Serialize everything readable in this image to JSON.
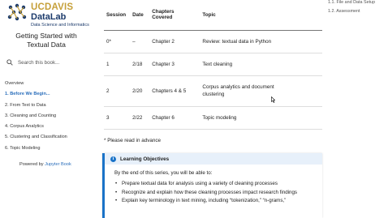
{
  "sidebar": {
    "brand_line1": "UCDAVIS",
    "brand_line2": "DataLab",
    "brand_line3": "Data Science and Informatics",
    "book_title_1": "Getting Started with",
    "book_title_2": "Textual Data",
    "search_placeholder": "Search this book...",
    "nav": [
      {
        "label": "Overview"
      },
      {
        "label": "1. Before We Begin..."
      },
      {
        "label": "2. From Text to Data"
      },
      {
        "label": "3. Cleaning and Counting"
      },
      {
        "label": "4. Corpus Analytics"
      },
      {
        "label": "5. Clustering and Classification"
      },
      {
        "label": "6. Topic Modeling"
      }
    ],
    "powered_prefix": "Powered by ",
    "powered_link": "Jupyter Book"
  },
  "table": {
    "headers": {
      "session": "Session",
      "date": "Date",
      "chapters_1": "Chapters",
      "chapters_2": "Covered",
      "topic": "Topic"
    },
    "rows": [
      {
        "session": "0*",
        "date": "–",
        "chapters": "Chapter 2",
        "topic": "Review: textual data in Python"
      },
      {
        "session": "1",
        "date": "2/18",
        "chapters": "Chapter 3",
        "topic": "Text cleaning"
      },
      {
        "session": "2",
        "date": "2/20",
        "chapters": "Chapters 4 & 5",
        "topic_1": "Corpus analytics and document",
        "topic_2": "clustering"
      },
      {
        "session": "3",
        "date": "2/22",
        "chapters": "Chapter 6",
        "topic": "Topic modeling"
      }
    ]
  },
  "note": "* Please read in advance",
  "objectives": {
    "title": "Learning Objectives",
    "intro": "By the end of this series, you will be able to:",
    "items": [
      "Prepare textual data for analysis using a variety of cleaning processes",
      "Recognize and explain how these cleaning processes impact research findings",
      "Explain key terminology in text mining, including “tokenization,” “n-grams,”"
    ]
  },
  "toc": {
    "items": [
      "1.1. File and Data Setup",
      "1.2. Assessment"
    ]
  },
  "colors": {
    "gold": "#C6A03A",
    "navy": "#1B3A6B",
    "link": "#2a6ebb",
    "admonition": "#1a73c8"
  }
}
